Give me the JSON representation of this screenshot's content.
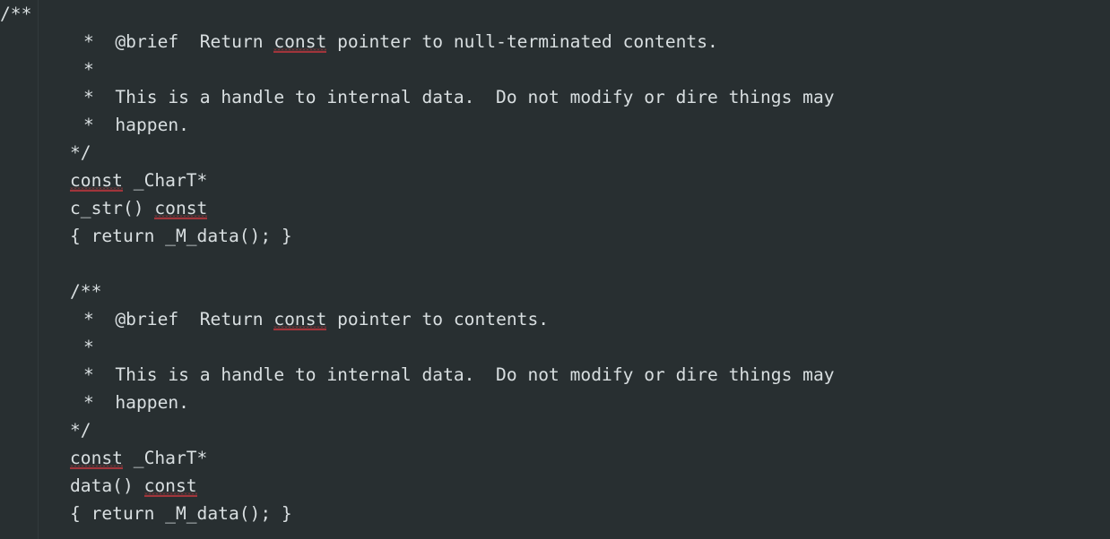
{
  "editor": {
    "kind": "code-editor",
    "language": "cpp",
    "background_color": "#282f31",
    "text_color": "#d9dfe1",
    "error_underline_color": "#a0353b",
    "indent_guide_color": "#323a3c",
    "font_size_px": 19.6,
    "line_height_px": 31
  },
  "code": {
    "lines": [
      {
        "indent": 0,
        "segments": [
          {
            "text": "/**"
          }
        ]
      },
      {
        "indent": 93,
        "segments": [
          {
            "text": "*  @brief  Return "
          },
          {
            "text": "const",
            "error": true
          },
          {
            "text": " pointer to null-terminated contents."
          }
        ]
      },
      {
        "indent": 93,
        "segments": [
          {
            "text": "*"
          }
        ]
      },
      {
        "indent": 93,
        "segments": [
          {
            "text": "*  This is a handle to internal data.  Do not modify or dire things may"
          }
        ]
      },
      {
        "indent": 93,
        "segments": [
          {
            "text": "*  happen."
          }
        ]
      },
      {
        "indent": 78,
        "segments": [
          {
            "text": "*/"
          }
        ]
      },
      {
        "indent": 78,
        "segments": [
          {
            "text": "const",
            "error": true
          },
          {
            "text": " _CharT*"
          }
        ]
      },
      {
        "indent": 78,
        "segments": [
          {
            "text": "c_str() "
          },
          {
            "text": "const",
            "error": true
          }
        ]
      },
      {
        "indent": 78,
        "segments": [
          {
            "text": "{ return _M_data(); }"
          }
        ]
      },
      {
        "indent": 78,
        "segments": [
          {
            "text": ""
          }
        ]
      },
      {
        "indent": 78,
        "segments": [
          {
            "text": "/**"
          }
        ]
      },
      {
        "indent": 93,
        "segments": [
          {
            "text": "*  @brief  Return "
          },
          {
            "text": "const",
            "error": true
          },
          {
            "text": " pointer to contents."
          }
        ]
      },
      {
        "indent": 93,
        "segments": [
          {
            "text": "*"
          }
        ]
      },
      {
        "indent": 93,
        "segments": [
          {
            "text": "*  This is a handle to internal data.  Do not modify or dire things may"
          }
        ]
      },
      {
        "indent": 93,
        "segments": [
          {
            "text": "*  happen."
          }
        ]
      },
      {
        "indent": 78,
        "segments": [
          {
            "text": "*/"
          }
        ]
      },
      {
        "indent": 78,
        "segments": [
          {
            "text": "const",
            "error": true
          },
          {
            "text": " _CharT*"
          }
        ]
      },
      {
        "indent": 78,
        "segments": [
          {
            "text": "data() "
          },
          {
            "text": "const",
            "error": true
          }
        ]
      },
      {
        "indent": 78,
        "segments": [
          {
            "text": "{ return _M_data(); }"
          }
        ]
      }
    ]
  },
  "guides": [
    {
      "x": 42
    }
  ]
}
